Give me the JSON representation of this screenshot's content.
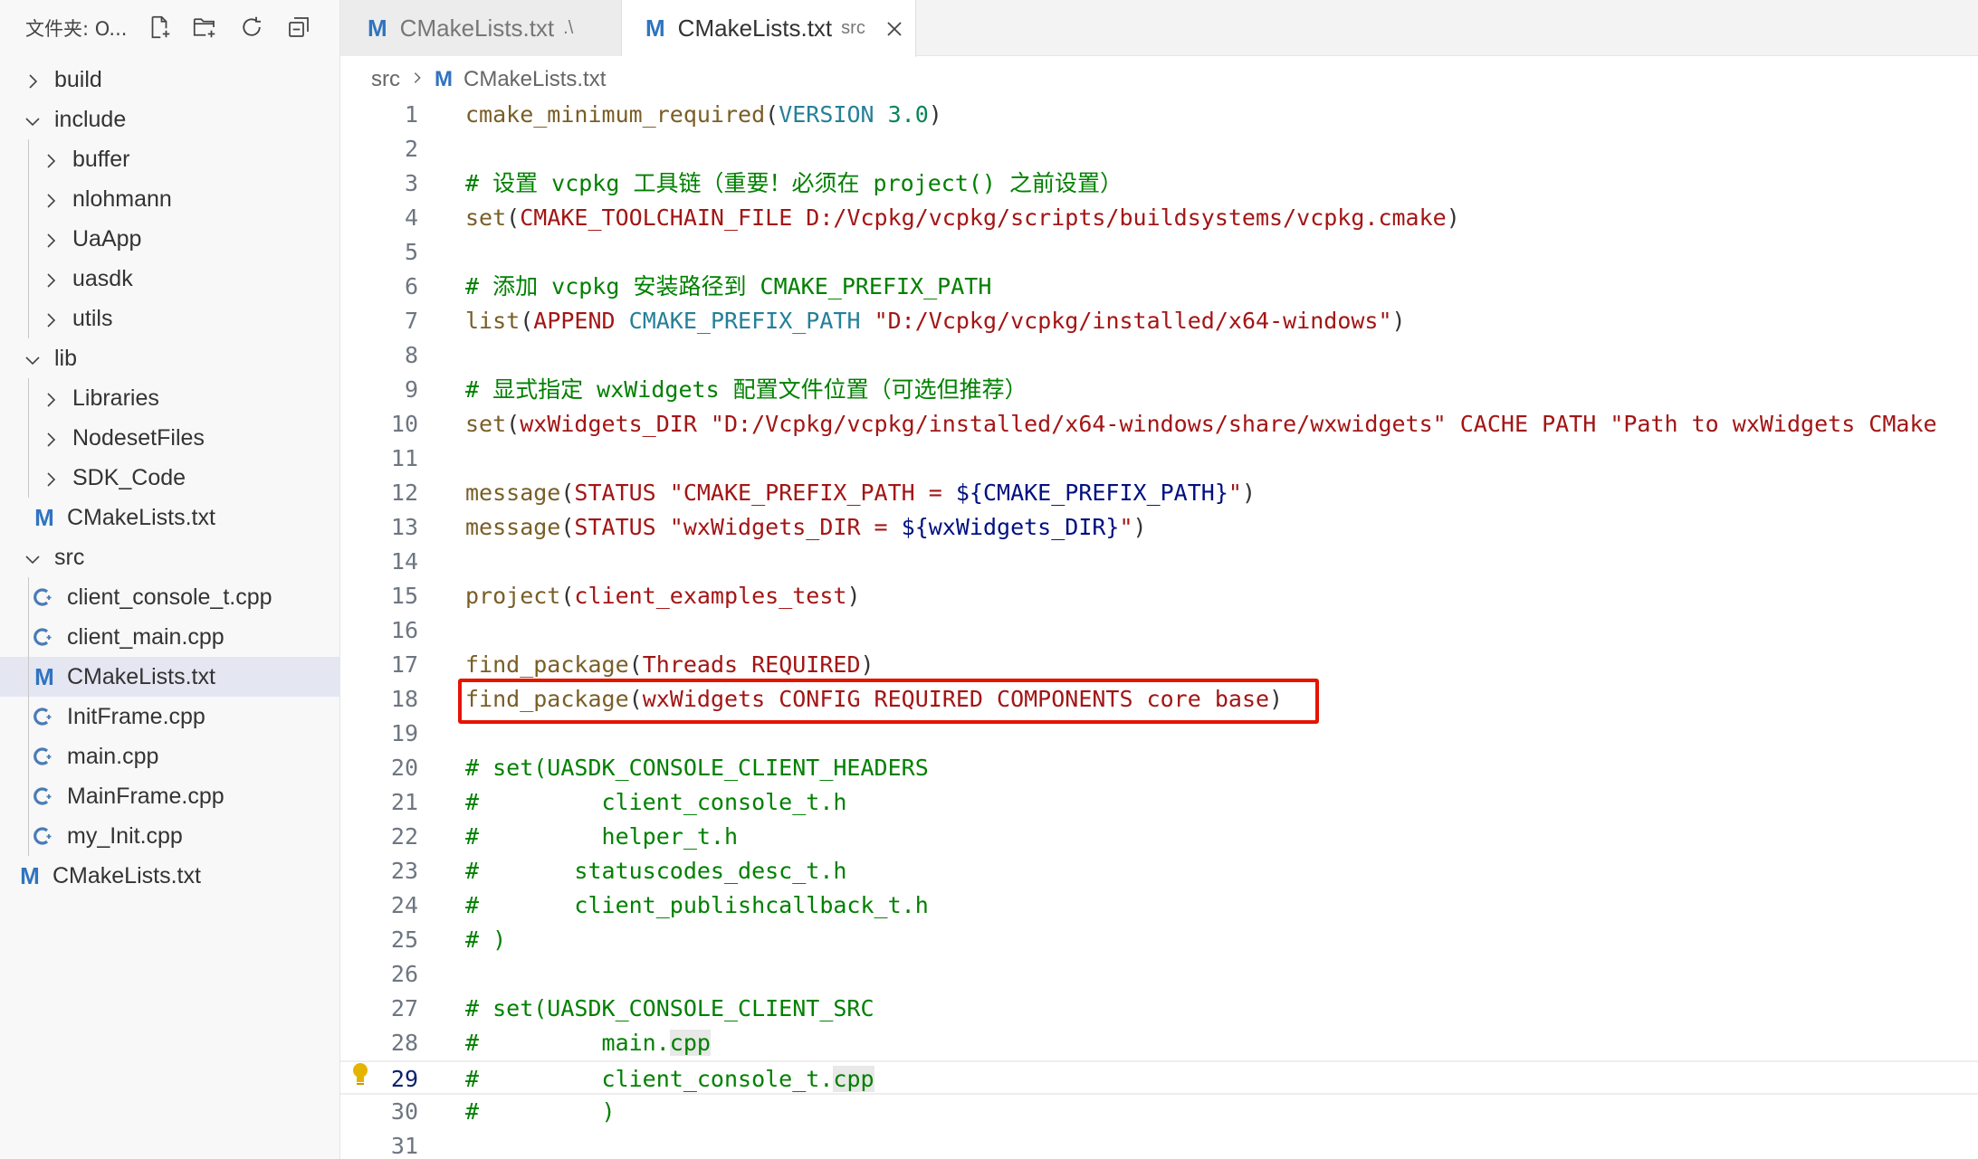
{
  "sidebar": {
    "title": "文件夹: O...",
    "actions": [
      {
        "name": "new-file-icon"
      },
      {
        "name": "new-folder-icon"
      },
      {
        "name": "refresh-icon"
      },
      {
        "name": "collapse-all-icon"
      }
    ],
    "tree": [
      {
        "label": "build",
        "kind": "folder",
        "expanded": false,
        "depth": 0
      },
      {
        "label": "include",
        "kind": "folder",
        "expanded": true,
        "depth": 0
      },
      {
        "label": "buffer",
        "kind": "folder",
        "expanded": false,
        "depth": 1
      },
      {
        "label": "nlohmann",
        "kind": "folder",
        "expanded": false,
        "depth": 1
      },
      {
        "label": "UaApp",
        "kind": "folder",
        "expanded": false,
        "depth": 1
      },
      {
        "label": "uasdk",
        "kind": "folder",
        "expanded": false,
        "depth": 1
      },
      {
        "label": "utils",
        "kind": "folder",
        "expanded": false,
        "depth": 1
      },
      {
        "label": "lib",
        "kind": "folder",
        "expanded": true,
        "depth": 0
      },
      {
        "label": "Libraries",
        "kind": "folder",
        "expanded": false,
        "depth": 1
      },
      {
        "label": "NodesetFiles",
        "kind": "folder",
        "expanded": false,
        "depth": 1
      },
      {
        "label": "SDK_Code",
        "kind": "folder",
        "expanded": false,
        "depth": 1
      },
      {
        "label": "CMakeLists.txt",
        "kind": "cmake",
        "depth": 1
      },
      {
        "label": "src",
        "kind": "folder",
        "expanded": true,
        "depth": 0
      },
      {
        "label": "client_console_t.cpp",
        "kind": "cpp",
        "depth": 1
      },
      {
        "label": "client_main.cpp",
        "kind": "cpp",
        "depth": 1
      },
      {
        "label": "CMakeLists.txt",
        "kind": "cmake",
        "depth": 1,
        "selected": true
      },
      {
        "label": "InitFrame.cpp",
        "kind": "cpp",
        "depth": 1
      },
      {
        "label": "main.cpp",
        "kind": "cpp",
        "depth": 1
      },
      {
        "label": "MainFrame.cpp",
        "kind": "cpp",
        "depth": 1
      },
      {
        "label": "my_Init.cpp",
        "kind": "cpp",
        "depth": 1
      },
      {
        "label": "CMakeLists.txt",
        "kind": "cmake",
        "depth": 0
      }
    ]
  },
  "tabs": [
    {
      "icon": "M",
      "label": "CMakeLists.txt",
      "desc": ".\\",
      "active": false
    },
    {
      "icon": "M",
      "label": "CMakeLists.txt",
      "desc": "src",
      "active": true
    }
  ],
  "breadcrumb": {
    "folder": "src",
    "icon": "M",
    "file": "CMakeLists.txt"
  },
  "colors": {
    "comment": "#008000",
    "function": "#795e26",
    "keyword": "#0000ff",
    "string": "#a31515",
    "variable": "#001080",
    "highlight_box": "#e51400",
    "cmake_icon": "#2f74c0",
    "cpp_icon": "#4a7bb7"
  },
  "editor": {
    "current_line": 29,
    "highlighted_line": 18,
    "lines": [
      {
        "n": "1",
        "tokens": [
          [
            "fn",
            "cmake_minimum_required"
          ],
          [
            "plain",
            "("
          ],
          [
            "kv",
            "VERSION"
          ],
          [
            "plain",
            " "
          ],
          [
            "num",
            "3.0"
          ],
          [
            "plain",
            ")"
          ]
        ]
      },
      {
        "n": "2",
        "tokens": []
      },
      {
        "n": "3",
        "tokens": [
          [
            "cmt",
            "# 设置 vcpkg 工具链（重要！必须在 project() 之前设置）"
          ]
        ]
      },
      {
        "n": "4",
        "tokens": [
          [
            "fn",
            "set"
          ],
          [
            "plain",
            "("
          ],
          [
            "str",
            "CMAKE_TOOLCHAIN_FILE D:/Vcpkg/vcpkg/scripts/buildsystems/vcpkg.cmake"
          ],
          [
            "plain",
            ")"
          ]
        ]
      },
      {
        "n": "5",
        "tokens": []
      },
      {
        "n": "6",
        "tokens": [
          [
            "cmt",
            "# 添加 vcpkg 安装路径到 CMAKE_PREFIX_PATH"
          ]
        ]
      },
      {
        "n": "7",
        "tokens": [
          [
            "fn",
            "list"
          ],
          [
            "plain",
            "("
          ],
          [
            "str",
            "APPEND "
          ],
          [
            "kv",
            "CMAKE_PREFIX_PATH"
          ],
          [
            "plain",
            " "
          ],
          [
            "str",
            "\"D:/Vcpkg/vcpkg/installed/x64-windows\""
          ],
          [
            "plain",
            ")"
          ]
        ]
      },
      {
        "n": "8",
        "tokens": []
      },
      {
        "n": "9",
        "tokens": [
          [
            "cmt",
            "# 显式指定 wxWidgets 配置文件位置（可选但推荐）"
          ]
        ]
      },
      {
        "n": "10",
        "tokens": [
          [
            "fn",
            "set"
          ],
          [
            "plain",
            "("
          ],
          [
            "str",
            "wxWidgets_DIR \"D:/Vcpkg/vcpkg/installed/x64-windows/share/wxwidgets\" CACHE PATH \"Path to wxWidgets CMake"
          ]
        ]
      },
      {
        "n": "11",
        "tokens": []
      },
      {
        "n": "12",
        "tokens": [
          [
            "fn",
            "message"
          ],
          [
            "plain",
            "("
          ],
          [
            "str",
            "STATUS \"CMAKE_PREFIX_PATH = "
          ],
          [
            "var",
            "${CMAKE_PREFIX_PATH}"
          ],
          [
            "str",
            "\""
          ],
          [
            "plain",
            ")"
          ]
        ]
      },
      {
        "n": "13",
        "tokens": [
          [
            "fn",
            "message"
          ],
          [
            "plain",
            "("
          ],
          [
            "str",
            "STATUS \"wxWidgets_DIR = "
          ],
          [
            "var",
            "${wxWidgets_DIR}"
          ],
          [
            "str",
            "\""
          ],
          [
            "plain",
            ")"
          ]
        ]
      },
      {
        "n": "14",
        "tokens": []
      },
      {
        "n": "15",
        "tokens": [
          [
            "fn",
            "project"
          ],
          [
            "plain",
            "("
          ],
          [
            "str",
            "client_examples_test"
          ],
          [
            "plain",
            ")"
          ]
        ]
      },
      {
        "n": "16",
        "tokens": []
      },
      {
        "n": "17",
        "tokens": [
          [
            "fn",
            "find_package"
          ],
          [
            "plain",
            "("
          ],
          [
            "str",
            "Threads REQUIRED"
          ],
          [
            "plain",
            ")"
          ]
        ]
      },
      {
        "n": "18",
        "tokens": [
          [
            "fn",
            "find_package"
          ],
          [
            "plain",
            "("
          ],
          [
            "str",
            "wxWidgets CONFIG REQUIRED COMPONENTS core base"
          ],
          [
            "plain",
            ")"
          ]
        ]
      },
      {
        "n": "19",
        "tokens": []
      },
      {
        "n": "20",
        "tokens": [
          [
            "cmt",
            "# set(UASDK_CONSOLE_CLIENT_HEADERS"
          ]
        ]
      },
      {
        "n": "21",
        "tokens": [
          [
            "cmt",
            "#         client_console_t.h"
          ]
        ]
      },
      {
        "n": "22",
        "tokens": [
          [
            "cmt",
            "#         helper_t.h"
          ]
        ]
      },
      {
        "n": "23",
        "tokens": [
          [
            "cmt",
            "#       statuscodes_desc_t.h"
          ]
        ]
      },
      {
        "n": "24",
        "tokens": [
          [
            "cmt",
            "#       client_publishcallback_t.h"
          ]
        ]
      },
      {
        "n": "25",
        "tokens": [
          [
            "cmt",
            "# )"
          ]
        ]
      },
      {
        "n": "26",
        "tokens": []
      },
      {
        "n": "27",
        "tokens": [
          [
            "cmt",
            "# set(UASDK_CONSOLE_CLIENT_SRC"
          ]
        ]
      },
      {
        "n": "28",
        "tokens": [
          [
            "cmt",
            "#         main."
          ],
          [
            "cmt hl",
            "cpp"
          ]
        ]
      },
      {
        "n": "29",
        "tokens": [
          [
            "cmt",
            "#         client_console_t."
          ],
          [
            "cmt hl",
            "cpp"
          ]
        ]
      },
      {
        "n": "30",
        "tokens": [
          [
            "cmt",
            "#         )"
          ]
        ]
      },
      {
        "n": "31",
        "tokens": []
      }
    ]
  }
}
